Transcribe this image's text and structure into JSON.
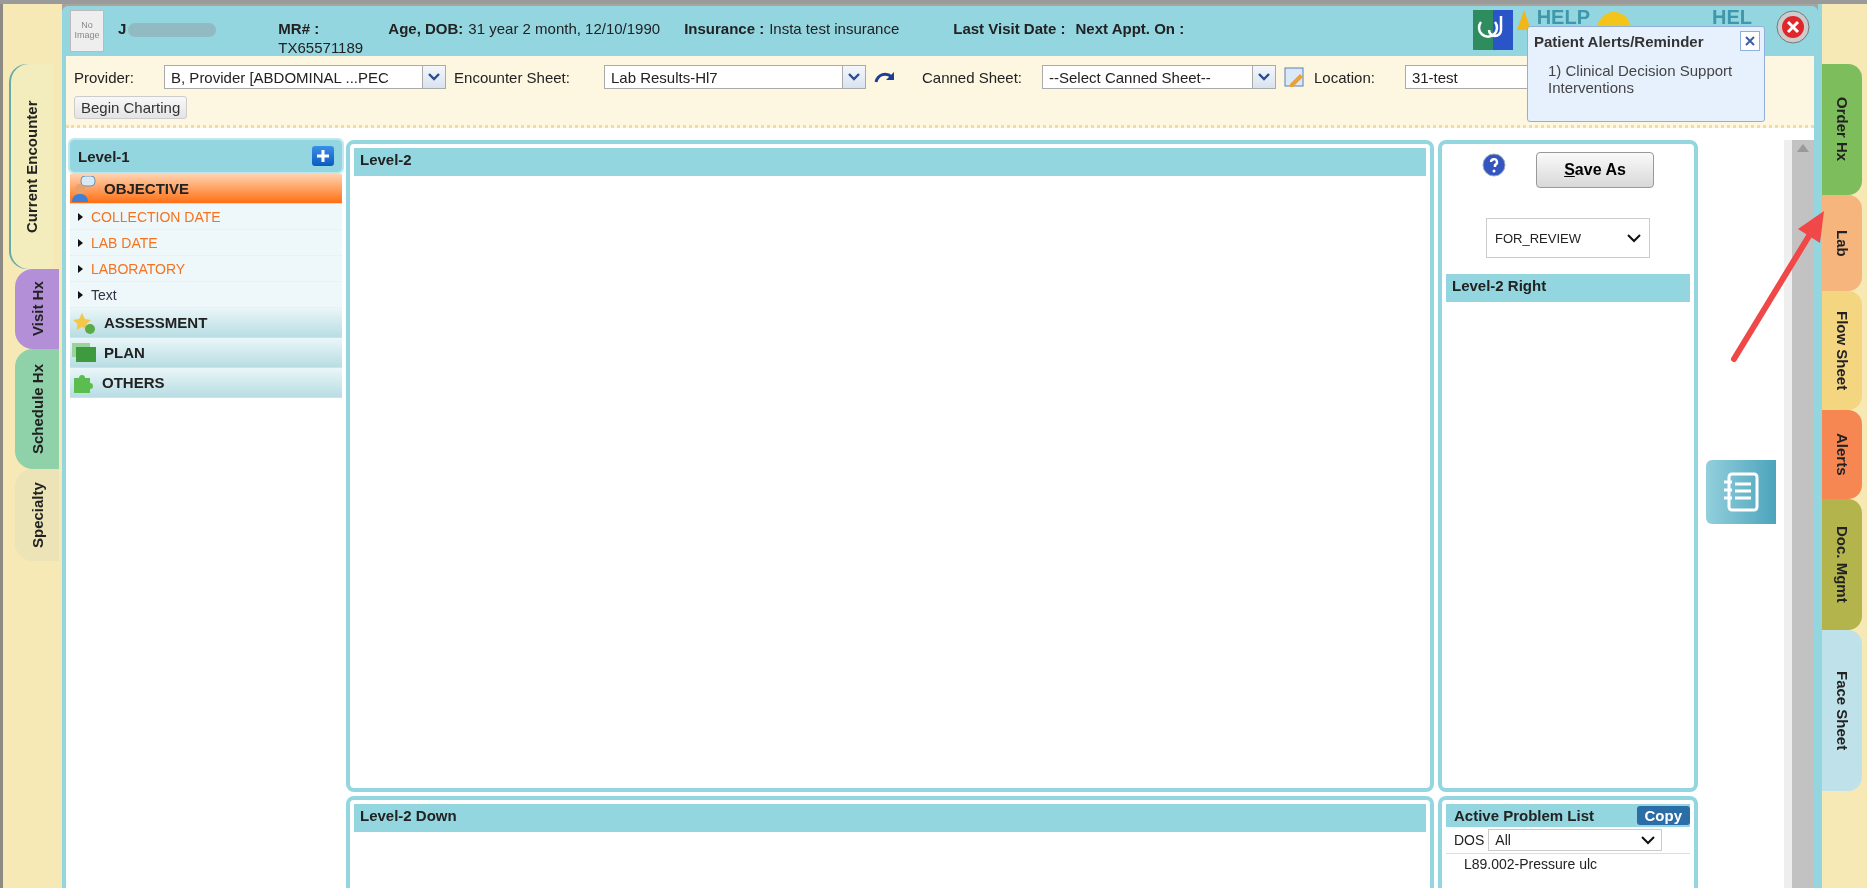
{
  "patient": {
    "photo": "No Image",
    "name": "J",
    "mr_label": "MR# :",
    "mr_value": "TX65571189",
    "age_label": "Age, DOB:",
    "age_value": "31 year 2 month, 12/10/1990",
    "insurance_label": "Insurance :",
    "insurance_value": "Insta test insurance",
    "last_visit_label": "Last Visit Date :",
    "next_appt_label": "Next Appt. On :"
  },
  "header_links": [
    "HELP",
    "HEL"
  ],
  "alert_popup": {
    "title": "Patient Alerts/Reminder",
    "items": [
      "1) Clinical Decision Support Interventions"
    ]
  },
  "toolbar": {
    "provider": {
      "label": "Provider:",
      "value": "B, Provider [ABDOMINAL ...PEC"
    },
    "encounter_sheet": {
      "label": "Encounter Sheet:",
      "value": "Lab Results-Hl7"
    },
    "canned_sheet": {
      "label": "Canned Sheet:",
      "value": "--Select Canned Sheet--"
    },
    "location": {
      "label": "Location:",
      "value": "31-test"
    },
    "begin_button": "Begin Charting"
  },
  "left_tabs": [
    {
      "label": "Current Encounter",
      "color": "#f3ecbd",
      "selected": true
    },
    {
      "label": "Visit Hx",
      "color": "#b38fd8",
      "selected": false
    },
    {
      "label": "Schedule Hx",
      "color": "#8fd1a9",
      "selected": false
    },
    {
      "label": "Specialty",
      "color": "#ece3b6",
      "selected": false
    }
  ],
  "level1": {
    "title": "Level-1",
    "sections": [
      {
        "label": "OBJECTIVE",
        "kind": "person",
        "selected": true,
        "items": [
          {
            "label": "COLLECTION DATE",
            "kind": "field"
          },
          {
            "label": "LAB DATE",
            "kind": "field"
          },
          {
            "label": "LABORATORY",
            "kind": "field"
          },
          {
            "label": "Text",
            "kind": "text"
          }
        ]
      },
      {
        "label": "ASSESSMENT",
        "kind": "star",
        "selected": false
      },
      {
        "label": "PLAN",
        "kind": "screen",
        "selected": false
      },
      {
        "label": "OTHERS",
        "kind": "puzzle",
        "selected": false
      }
    ]
  },
  "level2": {
    "title": "Level-2"
  },
  "level2_down": {
    "title": "Level-2 Down"
  },
  "right_panel": {
    "save_button": "Save As",
    "status": "FOR_REVIEW",
    "title": "Level-2 Right"
  },
  "problem_list": {
    "title": "Active Problem List",
    "copy_button": "Copy",
    "dos_label": "DOS",
    "dos_value": "All",
    "items": [
      "L89.002-Pressure ulc"
    ]
  },
  "right_tabs": [
    {
      "label": "Order Hx",
      "color": "#7dbd5b",
      "selected": false
    },
    {
      "label": "Lab",
      "color": "#f6b57c",
      "selected": false
    },
    {
      "label": "Flow Sheet",
      "color": "#f5d680",
      "selected": false
    },
    {
      "label": "Alerts",
      "color": "#f78752",
      "selected": false
    },
    {
      "label": "Doc. Mgmt",
      "color": "#b3b44c",
      "selected": false
    },
    {
      "label": "Face Sheet",
      "color": "#bfe2ea",
      "selected": false
    }
  ]
}
